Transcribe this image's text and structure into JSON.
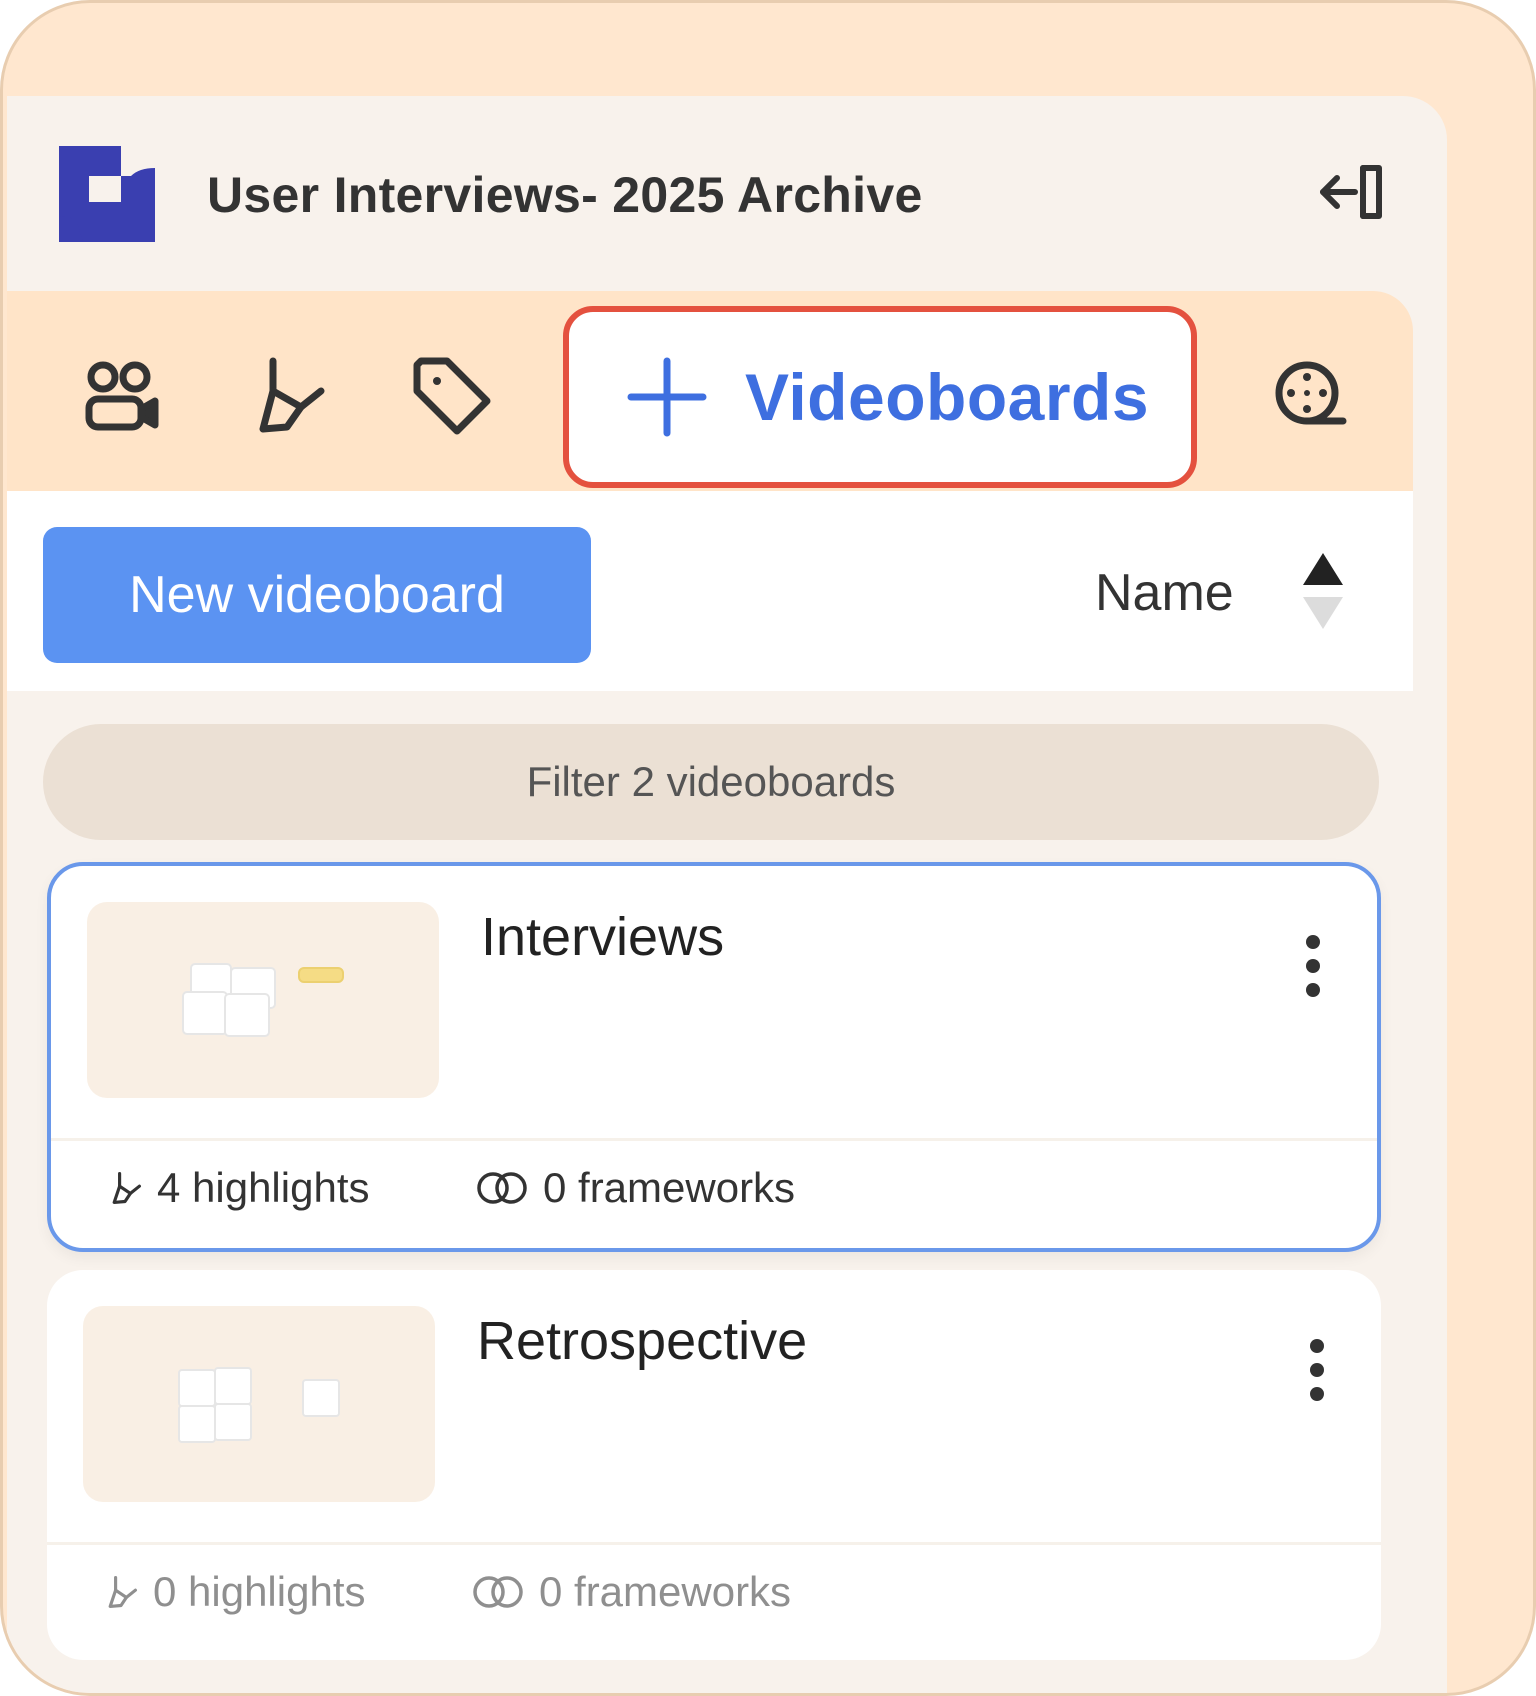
{
  "header": {
    "title": "User Interviews- 2025 Archive",
    "logo_icon": "brand-logo",
    "collapse_icon": "collapse-sidebar-icon",
    "brand_color": "#3a3fb0"
  },
  "tabs": {
    "items": [
      {
        "icon": "participants-icon"
      },
      {
        "icon": "highlighter-icon"
      },
      {
        "icon": "tag-icon"
      },
      {
        "icon": "plus-icon",
        "label": "Videoboards",
        "active": true
      },
      {
        "icon": "film-reel-icon"
      }
    ],
    "active_color": "#3e6fe0",
    "highlight_border": "#e4513f"
  },
  "toolbar": {
    "new_button_label": "New videoboard",
    "sort_label": "Name",
    "button_color": "#5b93f2"
  },
  "filter": {
    "placeholder": "Filter 2 videoboards"
  },
  "videoboards": [
    {
      "title": "Interviews",
      "highlights": "4 highlights",
      "frameworks": "0 frameworks",
      "selected": true
    },
    {
      "title": "Retrospective",
      "highlights": "0 highlights",
      "frameworks": "0 frameworks",
      "selected": false
    }
  ]
}
